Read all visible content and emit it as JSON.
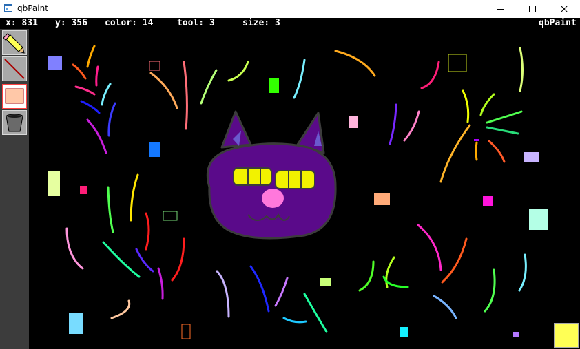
{
  "window": {
    "title": "qbPaint",
    "controls": [
      "minimize",
      "maximize",
      "close"
    ]
  },
  "status": {
    "x_label": "x: 831",
    "y_label": "y: 356",
    "color_label": "color: 14",
    "tool_label": "tool: 3",
    "size_label": "size: 3",
    "app_name": "qbPaint"
  },
  "tools": [
    {
      "name": "pencil",
      "icon": "pencil-icon",
      "selected": false
    },
    {
      "name": "line",
      "icon": "line-icon",
      "selected": false
    },
    {
      "name": "rectangle",
      "icon": "rectangle-icon",
      "selected": true
    },
    {
      "name": "fill",
      "icon": "bucket-icon",
      "selected": false
    }
  ],
  "current_color": "#ffff55",
  "canvas_background": "#000000",
  "cat": {
    "face_color": "#5a0a8a",
    "eyes_color": "#f2f200",
    "nose_color": "#ff78dc"
  }
}
